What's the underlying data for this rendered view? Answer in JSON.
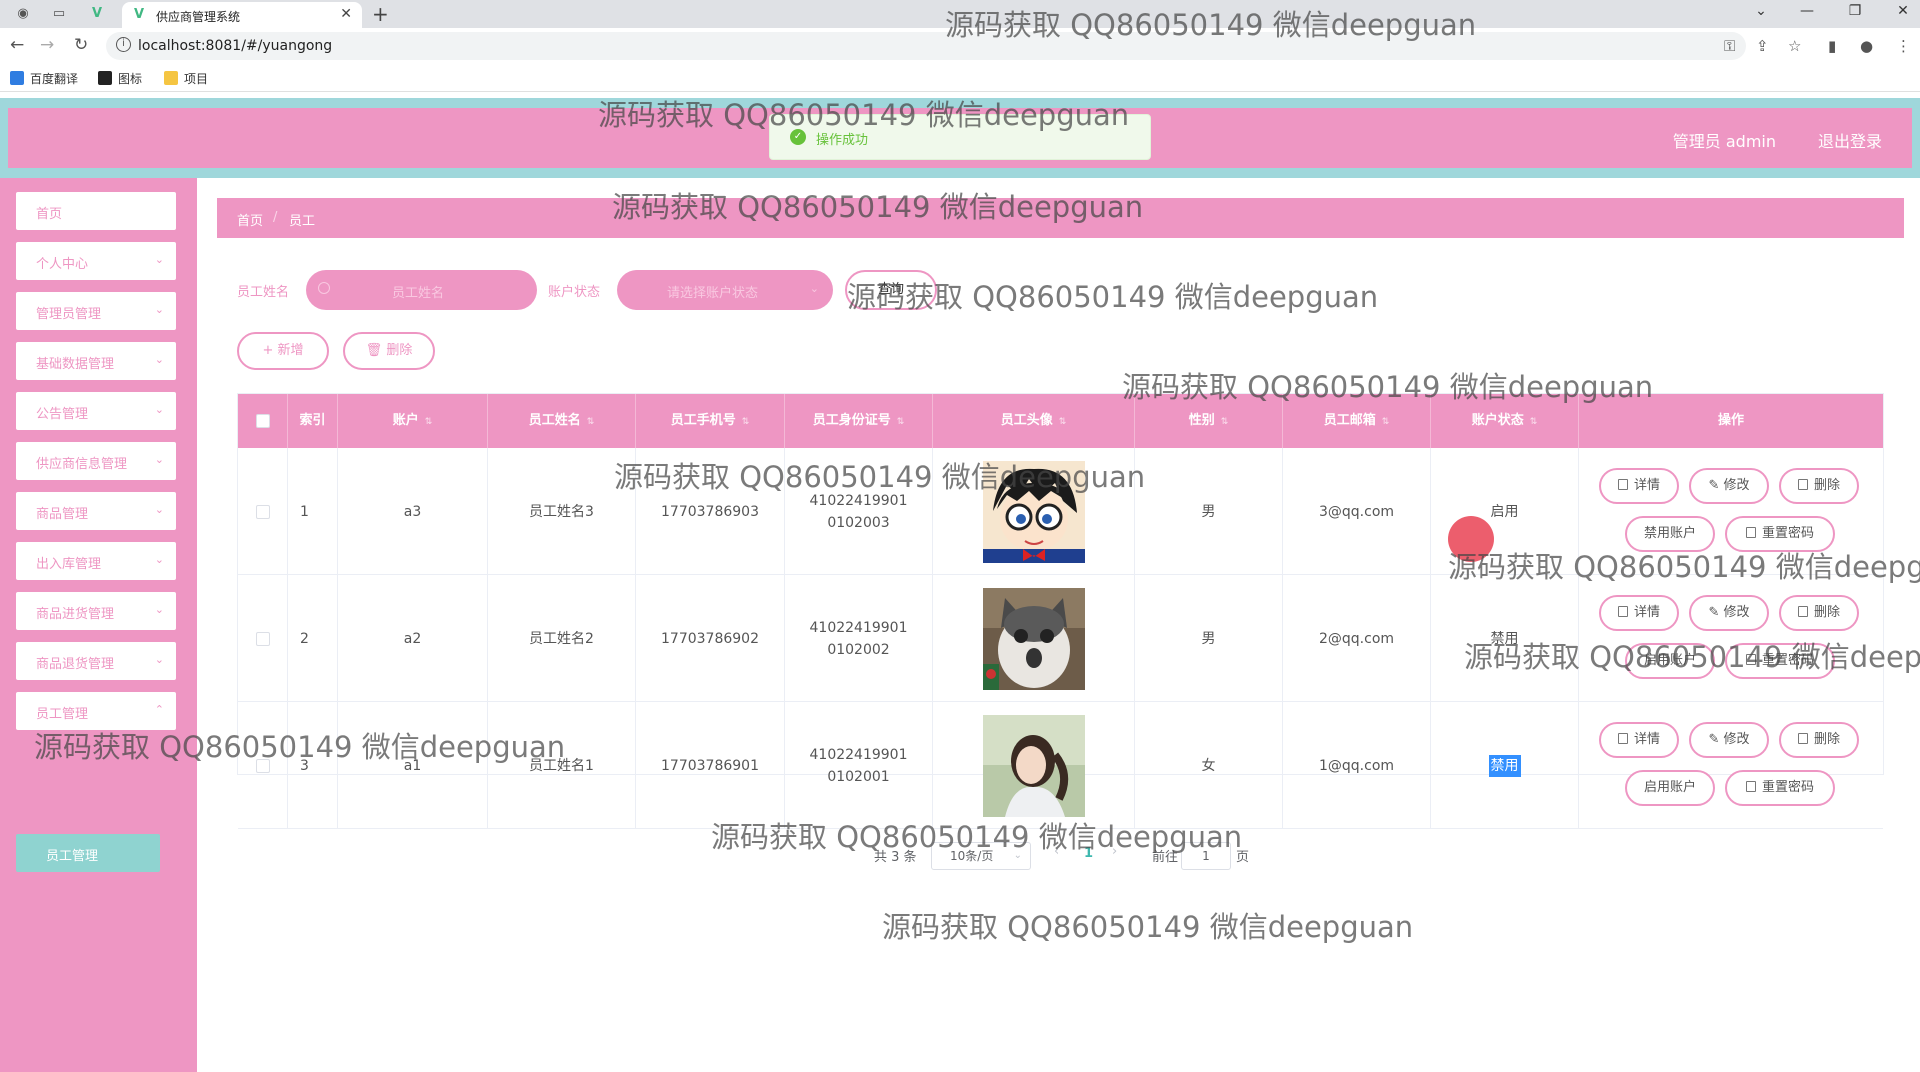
{
  "browser": {
    "tab_title": "供应商管理系统",
    "url": "localhost:8081/#/yuangong",
    "bookmarks": [
      "百度翻译",
      "图标",
      "项目"
    ]
  },
  "header": {
    "user_label": "管理员 admin",
    "logout_label": "退出登录"
  },
  "toast": {
    "message": "操作成功",
    "type": "success",
    "color": "#67c23a"
  },
  "theme": {
    "accent": "#ee96c3",
    "frame": "#9fd7db",
    "submenu": "#8fd3d0"
  },
  "sidebar": {
    "items": [
      {
        "label": "首页",
        "has_arrow": false
      },
      {
        "label": "个人中心",
        "has_arrow": true
      },
      {
        "label": "管理员管理",
        "has_arrow": true
      },
      {
        "label": "基础数据管理",
        "has_arrow": true
      },
      {
        "label": "公告管理",
        "has_arrow": true
      },
      {
        "label": "供应商信息管理",
        "has_arrow": true
      },
      {
        "label": "商品管理",
        "has_arrow": true
      },
      {
        "label": "出入库管理",
        "has_arrow": true
      },
      {
        "label": "商品进货管理",
        "has_arrow": true
      },
      {
        "label": "商品退货管理",
        "has_arrow": true
      },
      {
        "label": "员工管理",
        "has_arrow": true
      }
    ],
    "active_sub": "员工管理"
  },
  "breadcrumb": {
    "home": "首页",
    "separator": "/",
    "current": "员工"
  },
  "search": {
    "name_label": "员工姓名",
    "name_placeholder": "员工姓名",
    "status_label": "账户状态",
    "status_placeholder": "请选择账户状态",
    "query_button": "查询"
  },
  "actions": {
    "add": "+ 新增",
    "delete": "删除"
  },
  "table": {
    "columns": [
      "索引",
      "账户",
      "员工姓名",
      "员工手机号",
      "员工身份证号",
      "员工头像",
      "性别",
      "员工邮箱",
      "账户状态",
      "操作"
    ],
    "rows": [
      {
        "index": "1",
        "account": "a3",
        "name": "员工姓名3",
        "phone": "17703786903",
        "id_card": "410224199010102003",
        "avatar": "conan-avatar",
        "gender": "男",
        "email": "3@qq.com",
        "status": "启用",
        "toggle_label": "禁用账户"
      },
      {
        "index": "2",
        "account": "a2",
        "name": "员工姓名2",
        "phone": "17703786902",
        "id_card": "410224199010102002",
        "avatar": "cat-avatar",
        "gender": "男",
        "email": "2@qq.com",
        "status": "禁用",
        "toggle_label": "启用账户"
      },
      {
        "index": "3",
        "account": "a1",
        "name": "员工姓名1",
        "phone": "17703786901",
        "id_card": "410224199010102001",
        "avatar": "girl-avatar",
        "gender": "女",
        "email": "1@qq.com",
        "status": "禁用",
        "toggle_label": "启用账户"
      }
    ],
    "op_labels": {
      "detail": "详情",
      "edit": "修改",
      "delete": "删除",
      "reset": "重置密码"
    }
  },
  "pager": {
    "total": "共 3 条",
    "page_size": "10条/页",
    "prev": "‹",
    "current_page": "1",
    "next": "›",
    "goto_label": "前往",
    "goto_value": "1",
    "page_unit": "页"
  },
  "watermark": "源码获取 QQ86050149 微信deepguan"
}
